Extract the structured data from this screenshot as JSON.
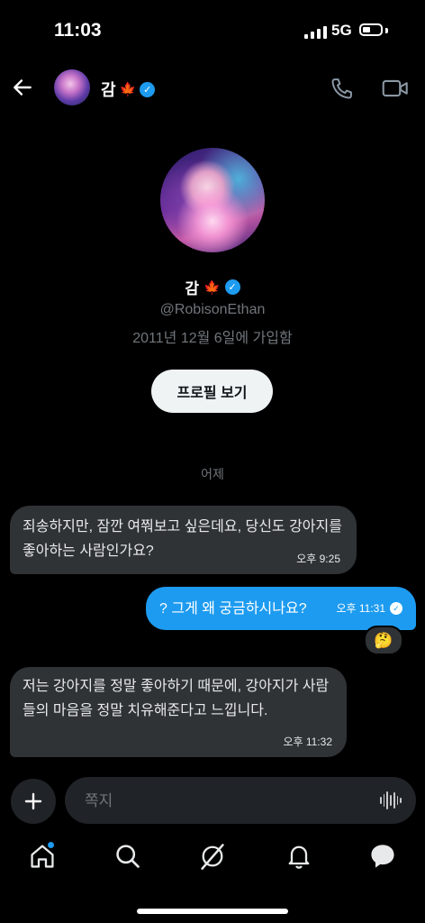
{
  "status_bar": {
    "time": "11:03",
    "network": "5G"
  },
  "header": {
    "name": "감",
    "name_emoji": "🍁"
  },
  "profile": {
    "name": "감",
    "name_emoji": "🍁",
    "handle": "@RobisonEthan",
    "joined": "2011년 12월 6일에 가입함",
    "view_profile_label": "프로필 보기"
  },
  "day_separator": "어제",
  "messages": [
    {
      "direction": "incoming",
      "text": "죄송하지만, 잠깐 여쭤보고 싶은데요, 당신도 강아지를 좋아하는 사람인가요?",
      "time": "오후 9:25"
    },
    {
      "direction": "outgoing",
      "text": "? 그게 왜 궁금하시나요?",
      "time": "오후 11:31",
      "reaction": "🤔"
    },
    {
      "direction": "incoming",
      "text": "저는 강아지를 정말 좋아하기 때문에, 강아지가 사람들의 마음을 정말 치유해준다고 느낍니다.",
      "time": "오후 11:32"
    }
  ],
  "composer": {
    "placeholder": "쪽지"
  },
  "tabs": [
    "home",
    "search",
    "grok",
    "notifications",
    "messages"
  ],
  "colors": {
    "accent": "#1d9bf0",
    "background": "#000000",
    "bubble_incoming": "#2f3336"
  }
}
